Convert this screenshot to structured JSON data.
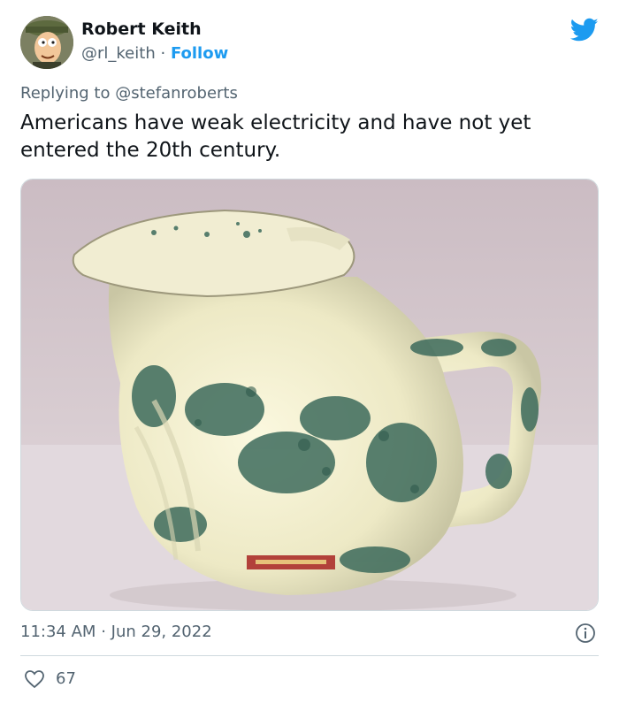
{
  "author": {
    "name": "Robert Keith",
    "handle": "@rl_keith",
    "separator": "·",
    "follow_label": "Follow"
  },
  "reply": {
    "prefix": "Replying to",
    "handle": "@stefanroberts"
  },
  "tweet": {
    "text": "Americans have weak electricity and have not yet entered the 20th century."
  },
  "meta": {
    "time": "11:34 AM",
    "separator": "·",
    "date": "Jun 29, 2022"
  },
  "engagement": {
    "likes": "67"
  },
  "colors": {
    "accent": "#1d9bf0",
    "text_primary": "#0f1419",
    "text_secondary": "#536471",
    "border": "#cfd9de"
  },
  "icons": {
    "brand": "twitter-bird-icon",
    "info": "info-icon",
    "like": "heart-icon"
  }
}
